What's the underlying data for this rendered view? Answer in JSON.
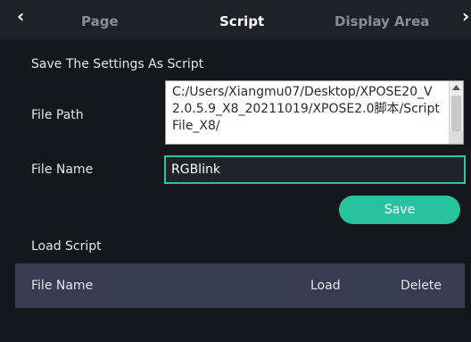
{
  "tabs": {
    "items": [
      "Page",
      "Script",
      "Display Area"
    ],
    "active": "Script",
    "prev_icon": "chevron-left-icon",
    "next_icon": "chevron-right-icon"
  },
  "save_section": {
    "title": "Save The Settings As Script",
    "file_path_label": "File Path",
    "file_path_value": "C:/Users/Xiangmu07/Desktop/XPOSE20_V2.0.5.9_X8_20211019/XPOSE2.0脚本/ScriptFile_X8/",
    "file_name_label": "File Name",
    "file_name_value": "RGBlink",
    "save_label": "Save"
  },
  "load_section": {
    "title": "Load Script",
    "columns": [
      "File Name",
      "Load",
      "Delete"
    ],
    "rows": []
  },
  "colors": {
    "accent": "#27c39f",
    "background": "#16171c",
    "header_row": "#383b52"
  }
}
